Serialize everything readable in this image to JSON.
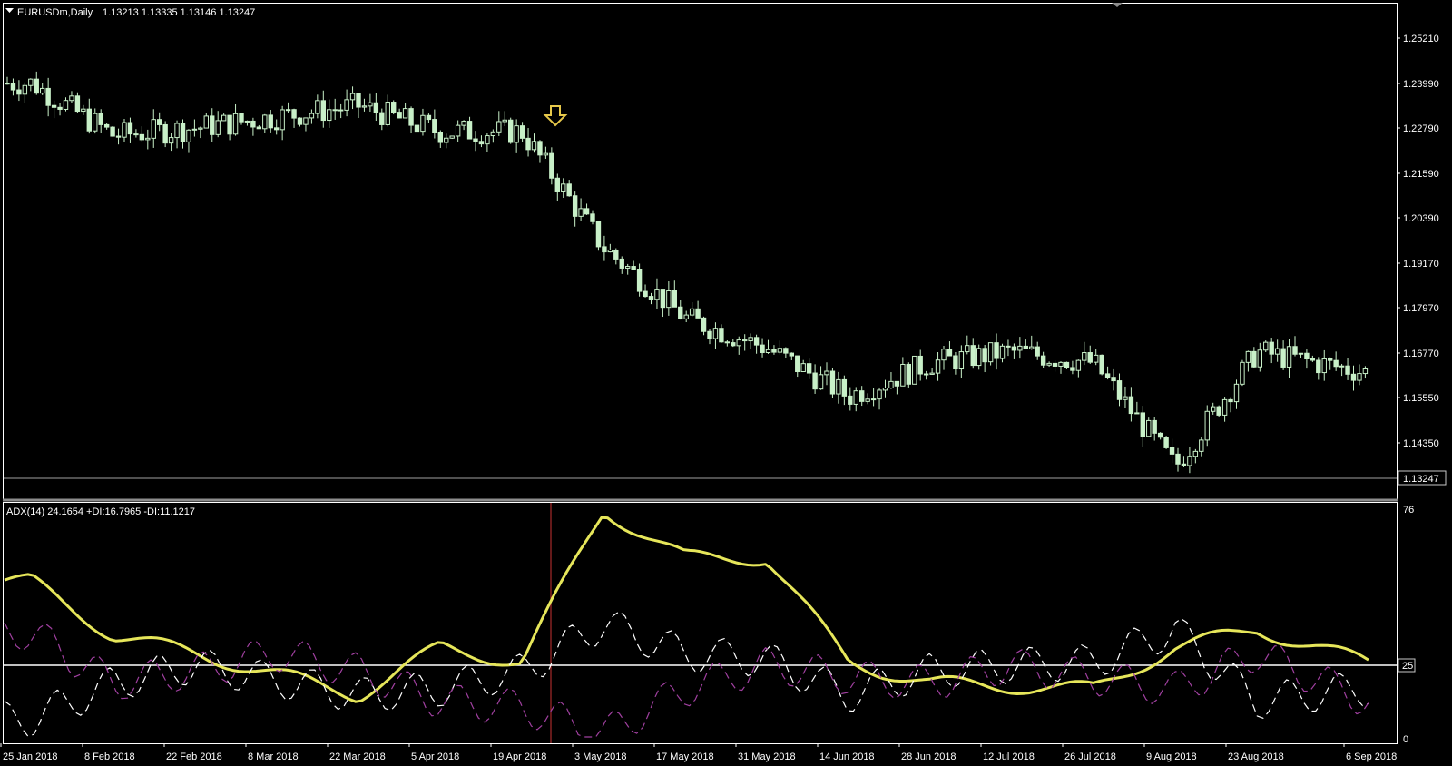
{
  "window": {
    "title": "EURUSDm,Daily",
    "ohlc": "1.13213 1.13335 1.13146 1.13247",
    "menu_icon": "triangle-down-icon"
  },
  "colors": {
    "background": "#000000",
    "frame": "#ffffff",
    "candle": "#c8f0c8",
    "adx": "#e6e65a",
    "plus_di": "#ffffff",
    "minus_di": "#a040a0",
    "vline": "#c83232",
    "arrow": "#e6c84a"
  },
  "price_panel": {
    "symbol": "EURUSDm",
    "timeframe": "Daily",
    "price_labels": [
      "1.25210",
      "1.23990",
      "1.22790",
      "1.21590",
      "1.20390",
      "1.19170",
      "1.17970",
      "1.16770",
      "1.15550",
      "1.14350"
    ],
    "current_price_label": "1.13247",
    "marker": "down-arrow-icon"
  },
  "indicator_panel": {
    "title": "ADX(14) 24.1654 +DI:16.7965 -DI:11.1217",
    "scale_labels": [
      "76",
      "25",
      "0"
    ],
    "level_label": "25"
  },
  "date_labels": [
    "25 Jan 2018",
    "8 Feb 2018",
    "22 Feb 2018",
    "8 Mar 2018",
    "22 Mar 2018",
    "5 Apr 2018",
    "19 Apr 2018",
    "3 May 2018",
    "17 May 2018",
    "31 May 2018",
    "14 Jun 2018",
    "28 Jun 2018",
    "12 Jul 2018",
    "26 Jul 2018",
    "9 Aug 2018",
    "23 Aug 2018",
    "6 Sep 2018"
  ],
  "chart_data": [
    {
      "type": "candlestick",
      "symbol": "EURUSDm",
      "timeframe": "Daily",
      "ylim": [
        1.128,
        1.259
      ],
      "current_price": 1.13247,
      "x_dates": [
        "25 Jan 2018",
        "8 Feb 2018",
        "22 Feb 2018",
        "8 Mar 2018",
        "22 Mar 2018",
        "5 Apr 2018",
        "19 Apr 2018",
        "3 May 2018",
        "17 May 2018",
        "31 May 2018",
        "14 Jun 2018",
        "28 Jun 2018",
        "12 Jul 2018",
        "26 Jul 2018",
        "9 Aug 2018",
        "23 Aug 2018",
        "6 Sep 2018"
      ],
      "close_points": [
        {
          "date": "25 Jan 2018",
          "close": 1.24
        },
        {
          "date": "8 Feb 2018",
          "close": 1.226
        },
        {
          "date": "22 Feb 2018",
          "close": 1.228
        },
        {
          "date": "8 Mar 2018",
          "close": 1.231
        },
        {
          "date": "22 Mar 2018",
          "close": 1.234
        },
        {
          "date": "5 Apr 2018",
          "close": 1.227
        },
        {
          "date": "19 Apr 2018",
          "close": 1.227
        },
        {
          "date": "3 May 2018",
          "close": 1.196
        },
        {
          "date": "17 May 2018",
          "close": 1.177
        },
        {
          "date": "31 May 2018",
          "close": 1.169
        },
        {
          "date": "14 Jun 2018",
          "close": 1.156
        },
        {
          "date": "28 Jun 2018",
          "close": 1.165
        },
        {
          "date": "12 Jul 2018",
          "close": 1.168
        },
        {
          "date": "26 Jul 2018",
          "close": 1.165
        },
        {
          "date": "9 Aug 2018",
          "close": 1.137
        },
        {
          "date": "23 Aug 2018",
          "close": 1.168
        },
        {
          "date": "6 Sep 2018",
          "close": 1.162
        }
      ]
    },
    {
      "type": "line",
      "title": "ADX(14) 24.1654 +DI:16.7965 -DI:11.1217",
      "ylim": [
        0,
        76
      ],
      "level": 25,
      "x_dates": [
        "25 Jan 2018",
        "8 Feb 2018",
        "22 Feb 2018",
        "8 Mar 2018",
        "22 Mar 2018",
        "5 Apr 2018",
        "19 Apr 2018",
        "3 May 2018",
        "17 May 2018",
        "31 May 2018",
        "14 Jun 2018",
        "28 Jun 2018",
        "12 Jul 2018",
        "26 Jul 2018",
        "9 Aug 2018",
        "23 Aug 2018",
        "6 Sep 2018"
      ],
      "series": [
        {
          "name": "ADX",
          "values": [
            52,
            34,
            28,
            21,
            14,
            30,
            25,
            76,
            60,
            60,
            25,
            18,
            17,
            16,
            30,
            36,
            24.1654
          ]
        },
        {
          "name": "+DI",
          "values": [
            6,
            18,
            24,
            19,
            14,
            16,
            22,
            38,
            28,
            26,
            14,
            22,
            24,
            25,
            36,
            12,
            16.7965
          ]
        },
        {
          "name": "-DI",
          "values": [
            35,
            18,
            22,
            28,
            22,
            12,
            10,
            1,
            16,
            24,
            20,
            18,
            24,
            20,
            16,
            28,
            11.1217
          ]
        }
      ]
    }
  ]
}
